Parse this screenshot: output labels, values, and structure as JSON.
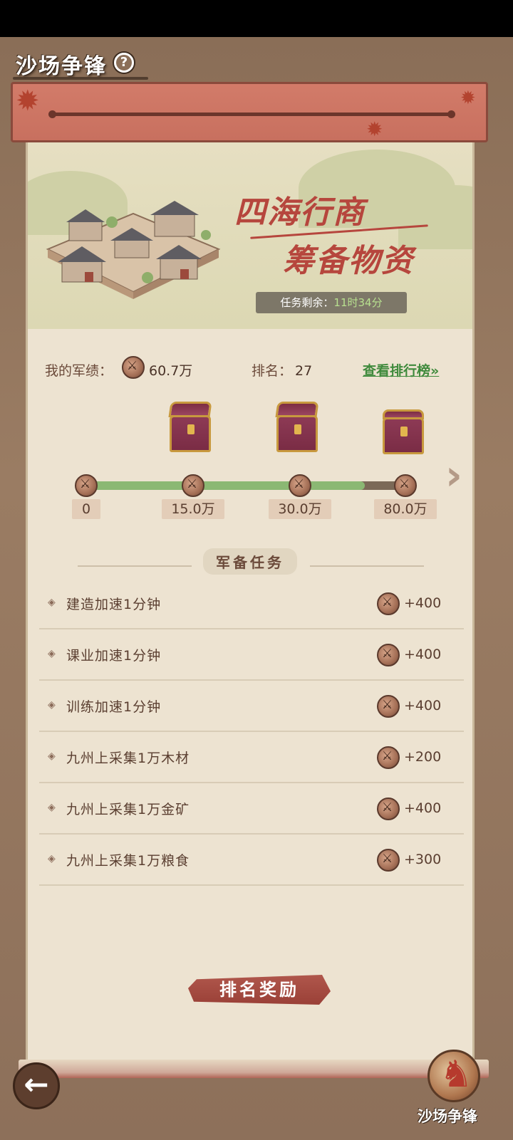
{
  "header": {
    "title": "沙场争锋",
    "help_icon": "?"
  },
  "banner": {
    "line1": "四海行商",
    "line2": "筹备物资",
    "timer_label": "任务剩余：",
    "timer_value": "11时34分"
  },
  "stats": {
    "merit_label": "我的军绩：",
    "merit_value": "60.7万",
    "rank_label": "排名：",
    "rank_value": "27",
    "ranking_link": "查看排行榜»"
  },
  "progress": {
    "current": "60.7万",
    "milestones": [
      {
        "label": "0",
        "chest": null
      },
      {
        "label": "15.0万",
        "chest": "opened"
      },
      {
        "label": "30.0万",
        "chest": "opened"
      },
      {
        "label": "80.0万",
        "chest": "closed"
      }
    ]
  },
  "tasks": {
    "section_title": "军备任务",
    "items": [
      {
        "label": "建造加速1分钟",
        "points": "+400"
      },
      {
        "label": "课业加速1分钟",
        "points": "+400"
      },
      {
        "label": "训练加速1分钟",
        "points": "+400"
      },
      {
        "label": "九州上采集1万木材",
        "points": "+200"
      },
      {
        "label": "九州上采集1万金矿",
        "points": "+400"
      },
      {
        "label": "九州上采集1万粮食",
        "points": "+300"
      }
    ]
  },
  "footer": {
    "reward_button": "排名奖励",
    "back_icon": "←",
    "corner_label": "沙场争锋"
  },
  "colors": {
    "accent_red": "#b6463d",
    "link_green": "#3f8a3c",
    "progress_green": "#8bb873"
  }
}
